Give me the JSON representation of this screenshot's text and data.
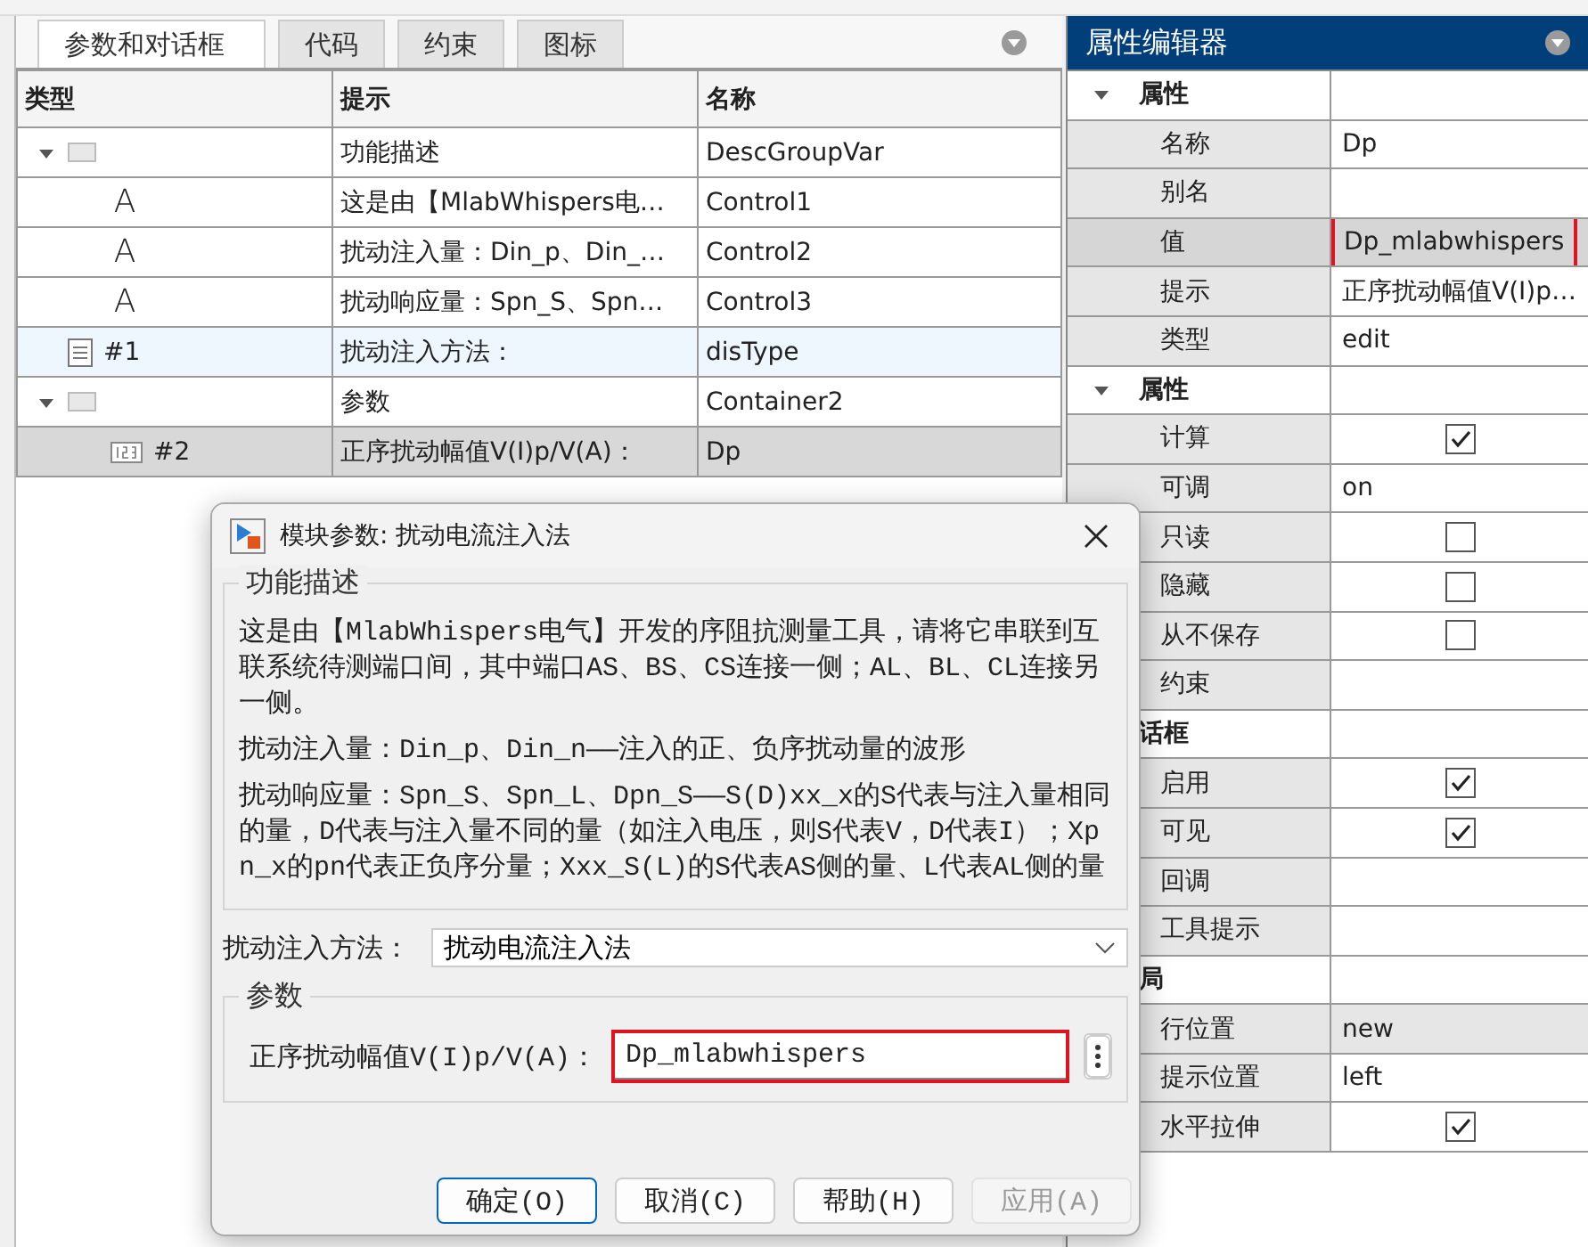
{
  "left_panel": {
    "tabs": [
      {
        "label": "参数和对话框",
        "selected": true
      },
      {
        "label": "代码",
        "selected": false
      },
      {
        "label": "约束",
        "selected": false
      },
      {
        "label": "图标",
        "selected": false
      }
    ],
    "table": {
      "columns": [
        "类型",
        "提示",
        "名称"
      ],
      "rows": [
        {
          "kind": "group",
          "expanded": true,
          "prompt": "功能描述",
          "name": "DescGroupVar",
          "selected": false,
          "hovered": false,
          "children": [
            {
              "kind": "text",
              "glyph": "A",
              "prompt": "这是由【MlabWhispers电…",
              "name": "Control1",
              "selected": false,
              "hovered": false
            },
            {
              "kind": "text",
              "glyph": "A",
              "prompt": "扰动注入量：Din_p、Din_…",
              "name": "Control2",
              "selected": false,
              "hovered": false
            },
            {
              "kind": "text",
              "glyph": "A",
              "prompt": "扰动响应量：Spn_S、Spn…",
              "name": "Control3",
              "selected": false,
              "hovered": false
            }
          ]
        },
        {
          "kind": "popup",
          "label": "#1",
          "prompt": "扰动注入方法：",
          "name": "disType",
          "selected": false,
          "hovered": true
        },
        {
          "kind": "group",
          "expanded": true,
          "prompt": "参数",
          "name": "Container2",
          "selected": false,
          "hovered": false,
          "children": [
            {
              "kind": "edit",
              "label": "#2",
              "prompt": "正序扰动幅值V(I)p/V(A)：",
              "name": "Dp",
              "selected": true,
              "hovered": false
            }
          ]
        }
      ]
    }
  },
  "property_editor": {
    "title": "属性编辑器",
    "rows": [
      {
        "kind": "section",
        "label": "属性",
        "expanded": true
      },
      {
        "kind": "text",
        "label": "名称",
        "value": "Dp",
        "selected": false,
        "editable": true
      },
      {
        "kind": "text",
        "label": "别名",
        "selected": false,
        "editable": true
      },
      {
        "kind": "text",
        "label": "值",
        "value": "Dp_mlabwhispers",
        "selected": true,
        "highlighted": true,
        "editable": true
      },
      {
        "kind": "text",
        "label": "提示",
        "value": "正序扰动幅值V(I)p…",
        "selected": false,
        "editable": true
      },
      {
        "kind": "text",
        "label": "类型",
        "value": "edit",
        "selected": false,
        "editable": true
      },
      {
        "kind": "section",
        "label": "属性",
        "expanded": true
      },
      {
        "kind": "check",
        "label": "计算",
        "checked": true
      },
      {
        "kind": "text",
        "label": "可调",
        "value": "on",
        "selected": false,
        "editable": true
      },
      {
        "kind": "check",
        "label": "只读",
        "checked": false
      },
      {
        "kind": "check",
        "label": "隐藏",
        "checked": false
      },
      {
        "kind": "check",
        "label": "从不保存",
        "checked": false
      },
      {
        "kind": "text",
        "label": "约束",
        "selected": false,
        "editable": true
      },
      {
        "kind": "section",
        "label": "话框"
      },
      {
        "kind": "check",
        "label": "启用",
        "checked": true
      },
      {
        "kind": "check",
        "label": "可见",
        "checked": true
      },
      {
        "kind": "text",
        "label": "回调",
        "selected": false,
        "editable": true
      },
      {
        "kind": "text",
        "label": "工具提示",
        "selected": false,
        "editable": true
      },
      {
        "kind": "section",
        "label": "局"
      },
      {
        "kind": "text",
        "label": "行位置",
        "value": "new",
        "selected": false,
        "editable": false
      },
      {
        "kind": "text",
        "label": "提示位置",
        "value": "left",
        "selected": false,
        "editable": true
      },
      {
        "kind": "check",
        "label": "水平拉伸",
        "checked": true
      }
    ]
  },
  "dialog": {
    "title": "模块参数: 扰动电流注入法",
    "description_group": {
      "title": "功能描述",
      "paragraphs": [
        "这是由【MlabWhispers电气】开发的序阻抗测量工具，请将它串联到互联系统待测端口间，其中端口AS、BS、CS连接一侧；AL、BL、CL连接另一侧。",
        "扰动注入量：Din_p、Din_n——注入的正、负序扰动量的波形",
        "扰动响应量：Spn_S、Spn_L、Dpn_S——S(D)xx_x的S代表与注入量相同的量，D代表与注入量不同的量（如注入电压，则S代表V，D代表I）；Xpn_x的pn代表正负序分量；Xxx_S(L)的S代表AS侧的量、L代表AL侧的量"
      ]
    },
    "method": {
      "label": "扰动注入方法：",
      "value": "扰动电流注入法"
    },
    "parameters_group": {
      "title": "参数",
      "fields": [
        {
          "label": "正序扰动幅值V(I)p/V(A)：",
          "value": "Dp_mlabwhispers",
          "highlighted": true
        }
      ]
    },
    "buttons": [
      {
        "label": "确定(O)",
        "default": true,
        "disabled": false
      },
      {
        "label": "取消(C)",
        "default": false,
        "disabled": false
      },
      {
        "label": "帮助(H)",
        "default": false,
        "disabled": false
      },
      {
        "label": "应用(A)",
        "default": false,
        "disabled": true
      }
    ]
  }
}
